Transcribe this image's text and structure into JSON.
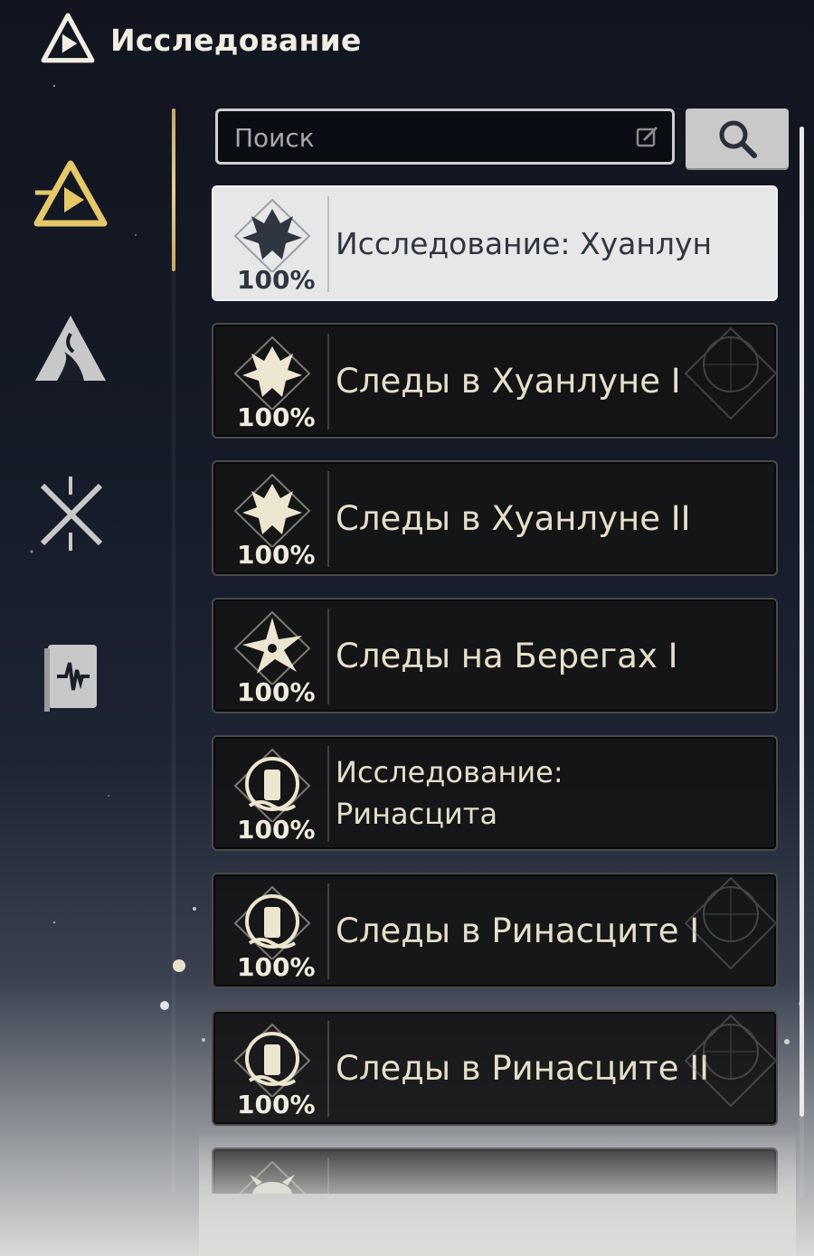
{
  "header": {
    "title": "Исследование",
    "logo_icon": "exploration-logo-icon"
  },
  "sidebar": {
    "tabs": [
      {
        "icon": "exploration-triangle-icon",
        "active": true
      },
      {
        "icon": "mountain-region-icon",
        "active": false
      },
      {
        "icon": "crossed-swords-icon",
        "active": false
      },
      {
        "icon": "codex-book-icon",
        "active": false
      }
    ]
  },
  "search": {
    "placeholder": "Поиск",
    "value": "",
    "edit_icon": "edit-icon",
    "button_icon": "search-icon"
  },
  "list": {
    "items": [
      {
        "label": "Исследование: Хуанлун",
        "percent": "100%",
        "icon": "dragon-crest-icon",
        "selected": true
      },
      {
        "label": "Следы в Хуанлуне I",
        "percent": "100%",
        "icon": "dragon-crest-icon",
        "selected": false
      },
      {
        "label": "Следы в Хуанлуне II",
        "percent": "100%",
        "icon": "dragon-crest-icon",
        "selected": false
      },
      {
        "label": "Следы на Берегах I",
        "percent": "100%",
        "icon": "star-flower-icon",
        "selected": false
      },
      {
        "label": "Исследование: Ринасцита",
        "percent": "100%",
        "icon": "lantern-wave-icon",
        "selected": false,
        "label_lines": [
          "Исследование:",
          "Ринасцита"
        ]
      },
      {
        "label": "Следы в Ринасците I",
        "percent": "100%",
        "icon": "lantern-wave-icon",
        "selected": false
      },
      {
        "label": "Следы в Ринасците II",
        "percent": "100%",
        "icon": "lantern-wave-icon",
        "selected": false
      },
      {
        "label": "",
        "percent": "",
        "icon": "creature-crest-icon",
        "selected": false
      }
    ]
  },
  "colors": {
    "accent_gold": "#e6c86a",
    "selected_bg": "#e7e7e7",
    "item_bg": "#141416"
  }
}
